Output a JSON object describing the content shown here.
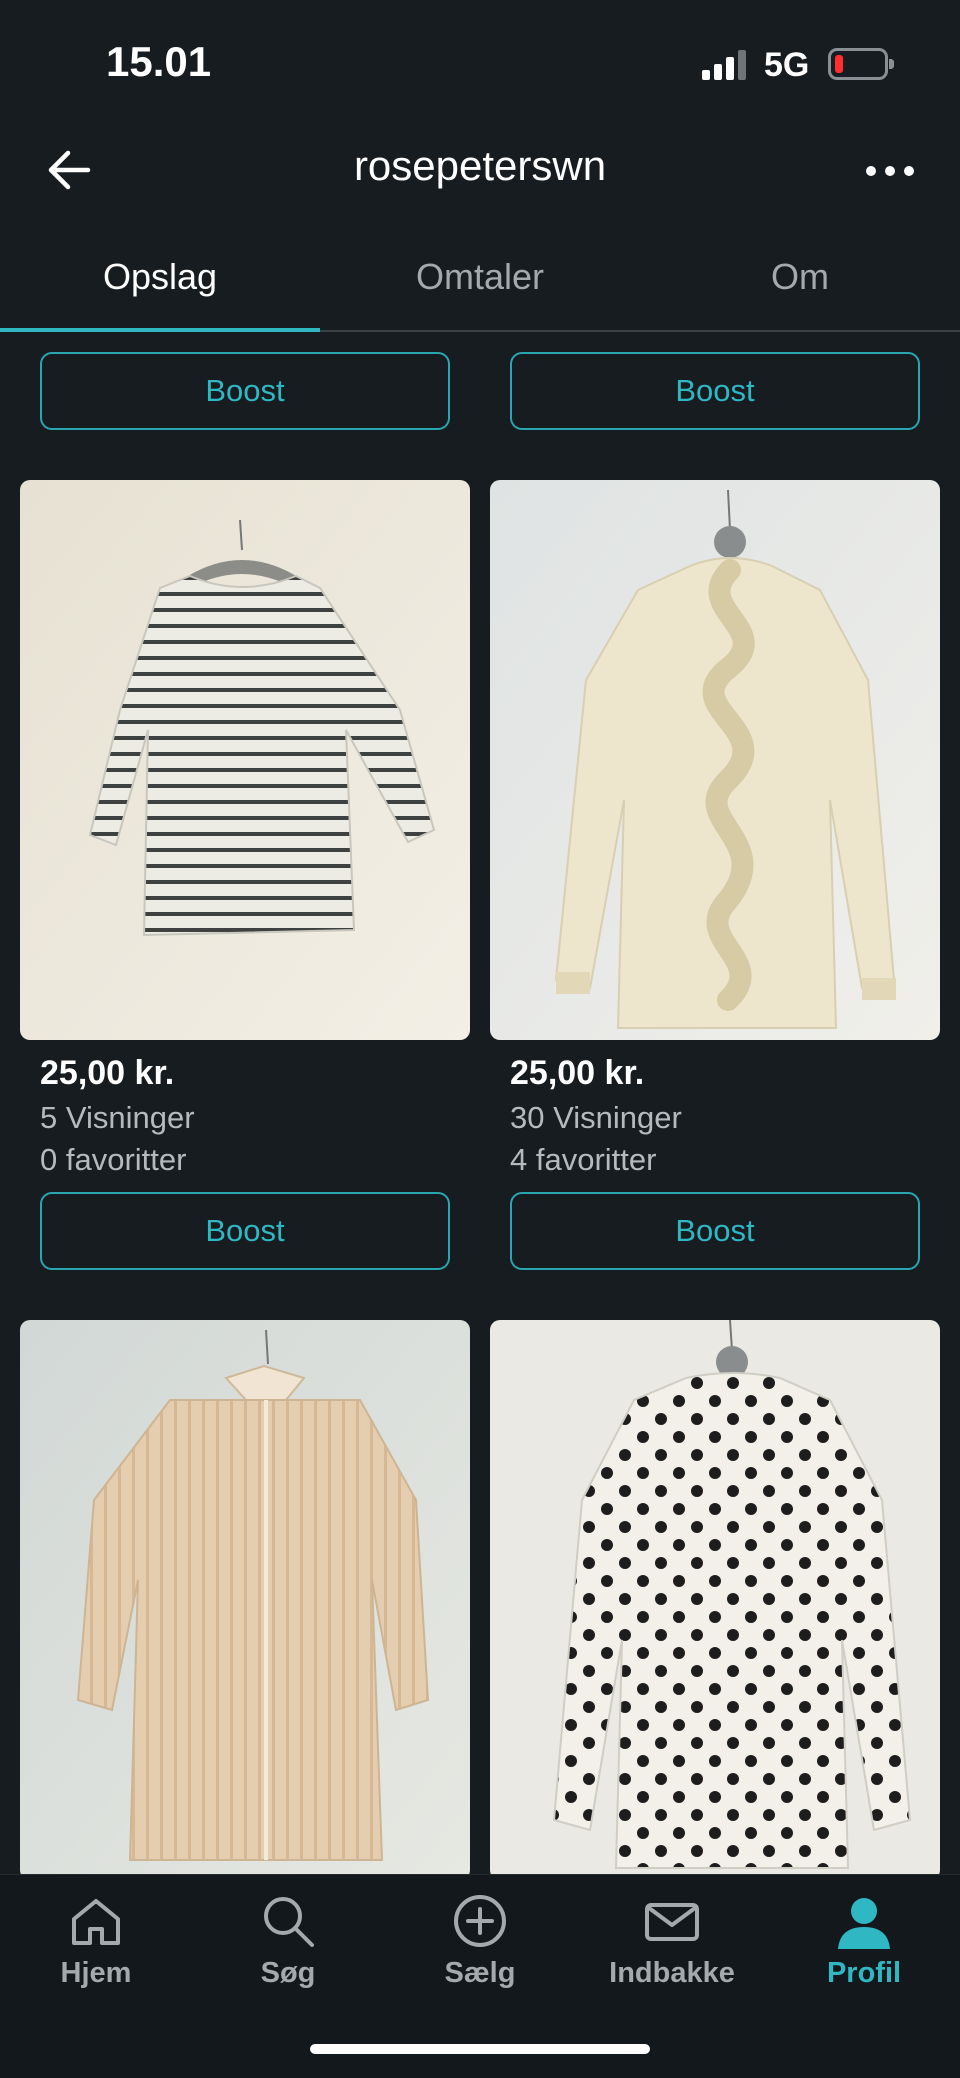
{
  "status_bar": {
    "time": "15.01",
    "network": "5G",
    "battery_color": "#ff2e2e"
  },
  "nav": {
    "title": "rosepeterswn",
    "back_icon": "arrow-left-icon",
    "more_icon": "more-horizontal-icon"
  },
  "tabs": [
    {
      "label": "Opslag",
      "active": true
    },
    {
      "label": "Omtaler",
      "active": false
    },
    {
      "label": "Om",
      "active": false
    }
  ],
  "top_row": {
    "boost_label": "Boost"
  },
  "listings": [
    {
      "price": "25,00 kr.",
      "views": "5 Visninger",
      "favorites": "0 favoritter",
      "boost_label": "Boost",
      "image": "striped-top"
    },
    {
      "price": "25,00 kr.",
      "views": "30 Visninger",
      "favorites": "4 favoritter",
      "boost_label": "Boost",
      "image": "ruffle-blouse"
    },
    {
      "image": "satin-shirt"
    },
    {
      "image": "polka-dot-blouse"
    }
  ],
  "tab_bar": [
    {
      "label": "Hjem",
      "icon": "home-icon",
      "active": false
    },
    {
      "label": "Søg",
      "icon": "search-icon",
      "active": false
    },
    {
      "label": "Sælg",
      "icon": "plus-circle-icon",
      "active": false
    },
    {
      "label": "Indbakke",
      "icon": "mail-icon",
      "active": false
    },
    {
      "label": "Profil",
      "icon": "profile-icon",
      "active": true
    }
  ],
  "colors": {
    "background": "#161c1f",
    "accent": "#2fb7c4",
    "muted_text": "#a3a9ad"
  }
}
